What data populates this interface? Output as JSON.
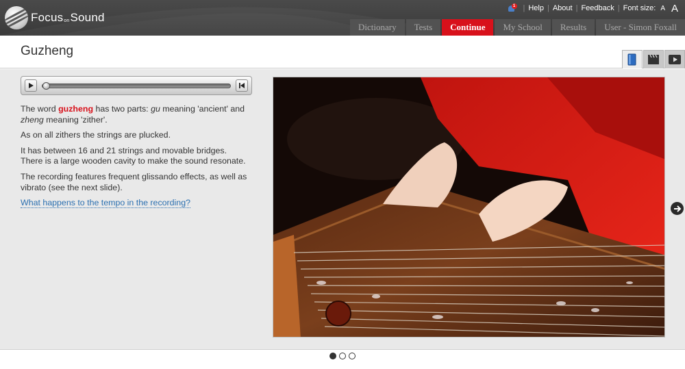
{
  "header": {
    "logo": {
      "text_before": "Focus",
      "text_small": "on",
      "text_after": "Sound"
    },
    "notification_count": "1",
    "links": {
      "help": "Help",
      "about": "About",
      "feedback": "Feedback",
      "font_size_label": "Font size:"
    },
    "font_small": "A",
    "font_large": "A",
    "nav": [
      {
        "label": "Dictionary"
      },
      {
        "label": "Tests"
      },
      {
        "label": "Continue",
        "active": true
      },
      {
        "label": "My School"
      },
      {
        "label": "Results"
      },
      {
        "label": "User - Simon Foxall"
      }
    ]
  },
  "page": {
    "title": "Guzheng",
    "view_tabs": [
      {
        "icon": "book-icon",
        "active": true
      },
      {
        "icon": "clapperboard-icon"
      },
      {
        "icon": "video-play-icon"
      }
    ]
  },
  "content": {
    "p1_a": "The word ",
    "p1_highlight": "guzheng",
    "p1_b": " has two parts: ",
    "p1_gu": "gu",
    "p1_c": " meaning 'ancient' and ",
    "p1_zheng": "zheng",
    "p1_d": " meaning 'zither'.",
    "p2": "As on all zithers the strings are plucked.",
    "p3_line1": "It has between 16 and 21 strings and movable bridges.",
    "p3_line2": "There is a large wooden cavity to make the sound resonate.",
    "p4_line1": "The recording features frequent glissando effects, as well as",
    "p4_line2": "vibrato (see the next slide).",
    "question_link": "What happens to the tempo in the recording?"
  },
  "slides": {
    "total": 3,
    "current": 1
  },
  "colors": {
    "accent": "#d8111b",
    "link": "#2a6fb0",
    "header_bg": "#444444",
    "content_bg": "#e9e9e9"
  }
}
